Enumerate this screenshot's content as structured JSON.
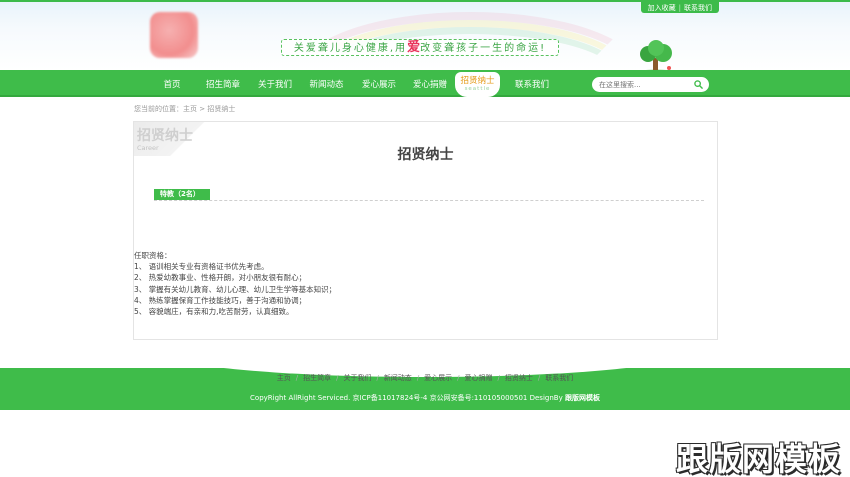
{
  "header": {
    "slogan_pre": "关爱聋儿身心健康,用",
    "slogan_love": "爱",
    "slogan_post": "改变聋孩子一生的命运!",
    "top_links": [
      "加入收藏",
      "联系我们"
    ]
  },
  "nav": {
    "items": [
      "首页",
      "招生简章",
      "关于我们",
      "新闻动态",
      "爱心展示",
      "爱心捐赠",
      "招贤纳士",
      "联系我们"
    ],
    "active_sub": "seattle",
    "search_placeholder": "在这里搜索..."
  },
  "breadcrumb": "您当前的位置：主页 > 招贤纳士",
  "content": {
    "corner_title": "招贤纳士",
    "corner_sub": "Career",
    "title": "招贤纳士",
    "job_tab": "特教（2名）",
    "requirements": [
      "任职资格：",
      "1、 语训相关专业有资格证书优先考虑。",
      "2、 热爱幼教事业、性格开朗，对小朋友很有耐心；",
      "3、 掌握有关幼儿教育、幼儿心理、幼儿卫生学等基本知识；",
      "4、 熟练掌握保育工作技能技巧，善于沟通和协调；",
      "5、 容貌端庄，有亲和力,吃苦耐劳，认真细致。"
    ]
  },
  "footer": {
    "links": [
      "主页",
      "招生简章",
      "关于我们",
      "新闻动态",
      "爱心展示",
      "爱心捐赠",
      "招贤纳士",
      "联系我们"
    ],
    "copyright": "CopyRight AllRight Serviced. 京ICP备11017824号-4 京公网安备号:110105000501 DesignBy",
    "designer": "跟版网模板"
  },
  "watermark": "跟版网模板",
  "colors": {
    "brand_green": "#3fbc4a",
    "active_orange": "#e59a17",
    "love_red": "#e8335b"
  },
  "icons": [
    "search-icon",
    "tree-icon",
    "logo-image"
  ]
}
